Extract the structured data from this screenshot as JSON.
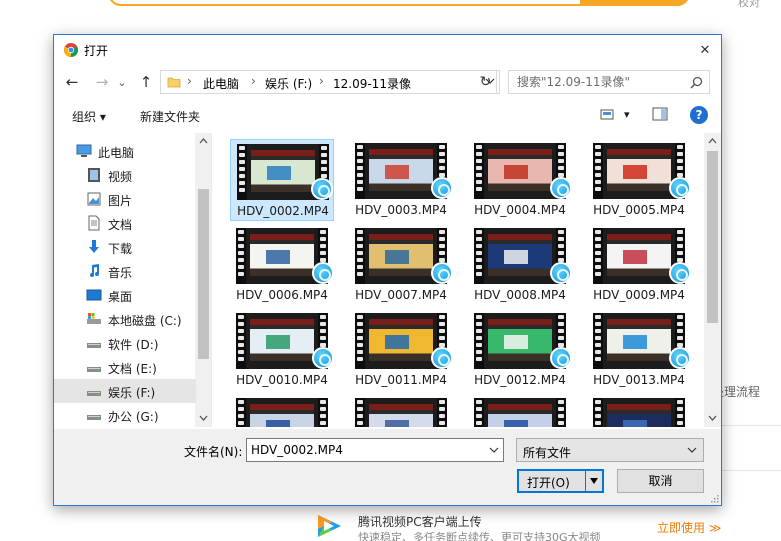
{
  "background": {
    "top_right_text": "校对",
    "side_text": "处理流程",
    "promo": {
      "title": "腾讯视频PC客户端上传",
      "subtitle": "快速稳定、多任务断点续传、更可支持30G大视频",
      "link": "立即使用 ≫"
    }
  },
  "dialog": {
    "title": "打开",
    "close_glyph": "✕",
    "nav": {
      "back": "←",
      "forward": "→",
      "recent": "⌄",
      "up": "↑",
      "breadcrumbs": [
        "此电脑",
        "娱乐 (F:)",
        "12.09-11录像"
      ],
      "separator": "›",
      "refresh": "↻"
    },
    "search": {
      "placeholder": "搜索\"12.09-11录像\""
    },
    "toolbar": {
      "organize": "组织 ▾",
      "new_folder": "新建文件夹",
      "view_menu": "▾",
      "help": "?"
    },
    "sidebar": [
      {
        "label": "此电脑",
        "icon": "computer-icon"
      },
      {
        "label": "视频",
        "icon": "video-folder-icon"
      },
      {
        "label": "图片",
        "icon": "picture-folder-icon"
      },
      {
        "label": "文档",
        "icon": "document-folder-icon"
      },
      {
        "label": "下载",
        "icon": "download-icon"
      },
      {
        "label": "音乐",
        "icon": "music-icon"
      },
      {
        "label": "桌面",
        "icon": "desktop-icon"
      },
      {
        "label": "本地磁盘 (C:)",
        "icon": "system-drive-icon"
      },
      {
        "label": "软件 (D:)",
        "icon": "drive-icon"
      },
      {
        "label": "文档 (E:)",
        "icon": "drive-icon"
      },
      {
        "label": "娱乐 (F:)",
        "icon": "drive-icon",
        "selected": true
      },
      {
        "label": "办公 (G:)",
        "icon": "drive-icon"
      }
    ],
    "files": [
      {
        "name": "HDV_0002.MP4",
        "selected": true,
        "screen": "#d8e8d0",
        "accent": "#2a7fbf"
      },
      {
        "name": "HDV_0003.MP4",
        "screen": "#c8d8e8",
        "accent": "#d04030"
      },
      {
        "name": "HDV_0004.MP4",
        "screen": "#e8b8b0",
        "accent": "#c03020"
      },
      {
        "name": "HDV_0005.MP4",
        "screen": "#f0e0d8",
        "accent": "#d02818"
      },
      {
        "name": "HDV_0006.MP4",
        "screen": "#f4f4f0",
        "accent": "#3060a0"
      },
      {
        "name": "HDV_0007.MP4",
        "screen": "#e0c070",
        "accent": "#2c6a9a"
      },
      {
        "name": "HDV_0008.MP4",
        "screen": "#1c3a7a",
        "accent": "#f0f0f0"
      },
      {
        "name": "HDV_0009.MP4",
        "screen": "#f4f4f4",
        "accent": "#c03040"
      },
      {
        "name": "HDV_0010.MP4",
        "screen": "#e4eef4",
        "accent": "#2a9a6a"
      },
      {
        "name": "HDV_0011.MP4",
        "screen": "#f0b830",
        "accent": "#1e6ab0"
      },
      {
        "name": "HDV_0012.MP4",
        "screen": "#38b86a",
        "accent": "#f4f4f4"
      },
      {
        "name": "HDV_0013.MP4",
        "screen": "#f0f0ea",
        "accent": "#1e8ad8"
      },
      {
        "name": "",
        "screen": "#c8d4e4",
        "accent": "#1e4a9a"
      },
      {
        "name": "",
        "screen": "#d4dcec",
        "accent": "#3a5a9a"
      },
      {
        "name": "",
        "screen": "#c4d0e8",
        "accent": "#2050a0"
      },
      {
        "name": "",
        "screen": "#1c2c5c",
        "accent": "#4070c0"
      }
    ],
    "bottom": {
      "filename_label": "文件名(N):",
      "filename_value": "HDV_0002.MP4",
      "filetype": "所有文件",
      "open_label": "打开(O)",
      "cancel_label": "取消"
    },
    "colors": {
      "accent": "#0078d7",
      "selection": "#cce8ff",
      "help": "#1f6fd0"
    }
  }
}
